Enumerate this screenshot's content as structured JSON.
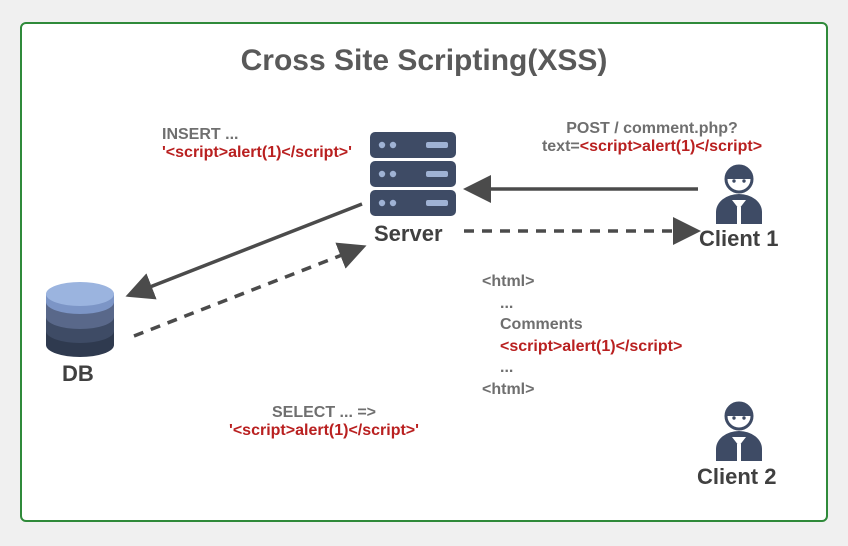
{
  "title": "Cross Site Scripting(XSS)",
  "nodes": {
    "server": "Server",
    "db": "DB",
    "client1": "Client 1",
    "client2": "Client 2"
  },
  "labels": {
    "insert_prefix": "INSERT ...",
    "insert_payload": "'<script>alert(1)</script>'",
    "select_prefix": "SELECT ... =>",
    "select_payload": "'<script>alert(1)</script>'",
    "post_line1": "POST / comment.php?",
    "post_line2_prefix": "text=",
    "post_line2_payload": "<script>alert(1)</script>",
    "resp_l1": "<html>",
    "resp_l2": "...",
    "resp_l3": "Comments",
    "resp_l4": "<script>alert(1)</script>",
    "resp_l5": "...",
    "resp_l6": "<html>"
  }
}
